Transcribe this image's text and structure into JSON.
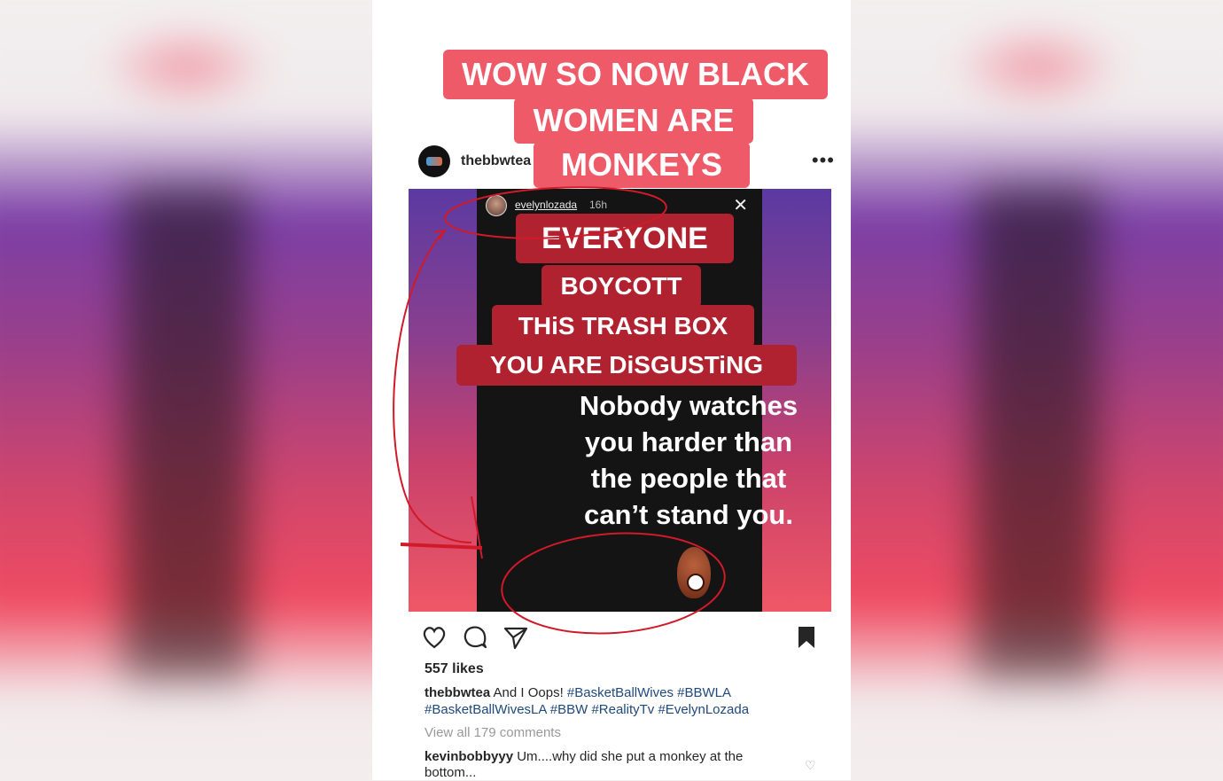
{
  "headline": [
    "WOW SO NOW BLACK",
    "WOMEN ARE",
    "MONKEYS"
  ],
  "post": {
    "username": "thebbwtea",
    "more": "•••",
    "likes": "557 likes",
    "caption_user": "thebbwtea",
    "caption_text": "And I Oops!",
    "hashtags": [
      "#BasketBallWives",
      "#BBWLA",
      "#BasketBallWivesLA",
      "#BBW",
      "#RealityTv",
      "#EvelynLozada"
    ],
    "view_all": "View all 179 comments",
    "comment_user": "kevinbobbyyy",
    "comment_text": "Um....why did she put a monkey at the bottom..."
  },
  "story": {
    "user": "evelynlozada",
    "time": "16h",
    "close": "✕",
    "tags": [
      "EVERYONE",
      "BOYCOTT",
      "THiS TRASH BOX",
      "YOU ARE DiSGUSTiNG"
    ],
    "quote": [
      "Nobody watches",
      "you harder than",
      "the people that",
      "can’t stand you."
    ]
  },
  "icons": {
    "heart": "heart-icon",
    "comment": "comment-icon",
    "share": "send-icon",
    "save": "bookmark-icon"
  },
  "colors": {
    "headline_bg": "#ef5a68",
    "tag_bg": "#b0222f",
    "hashtag": "#20497c",
    "annotation": "#d01a2a"
  }
}
